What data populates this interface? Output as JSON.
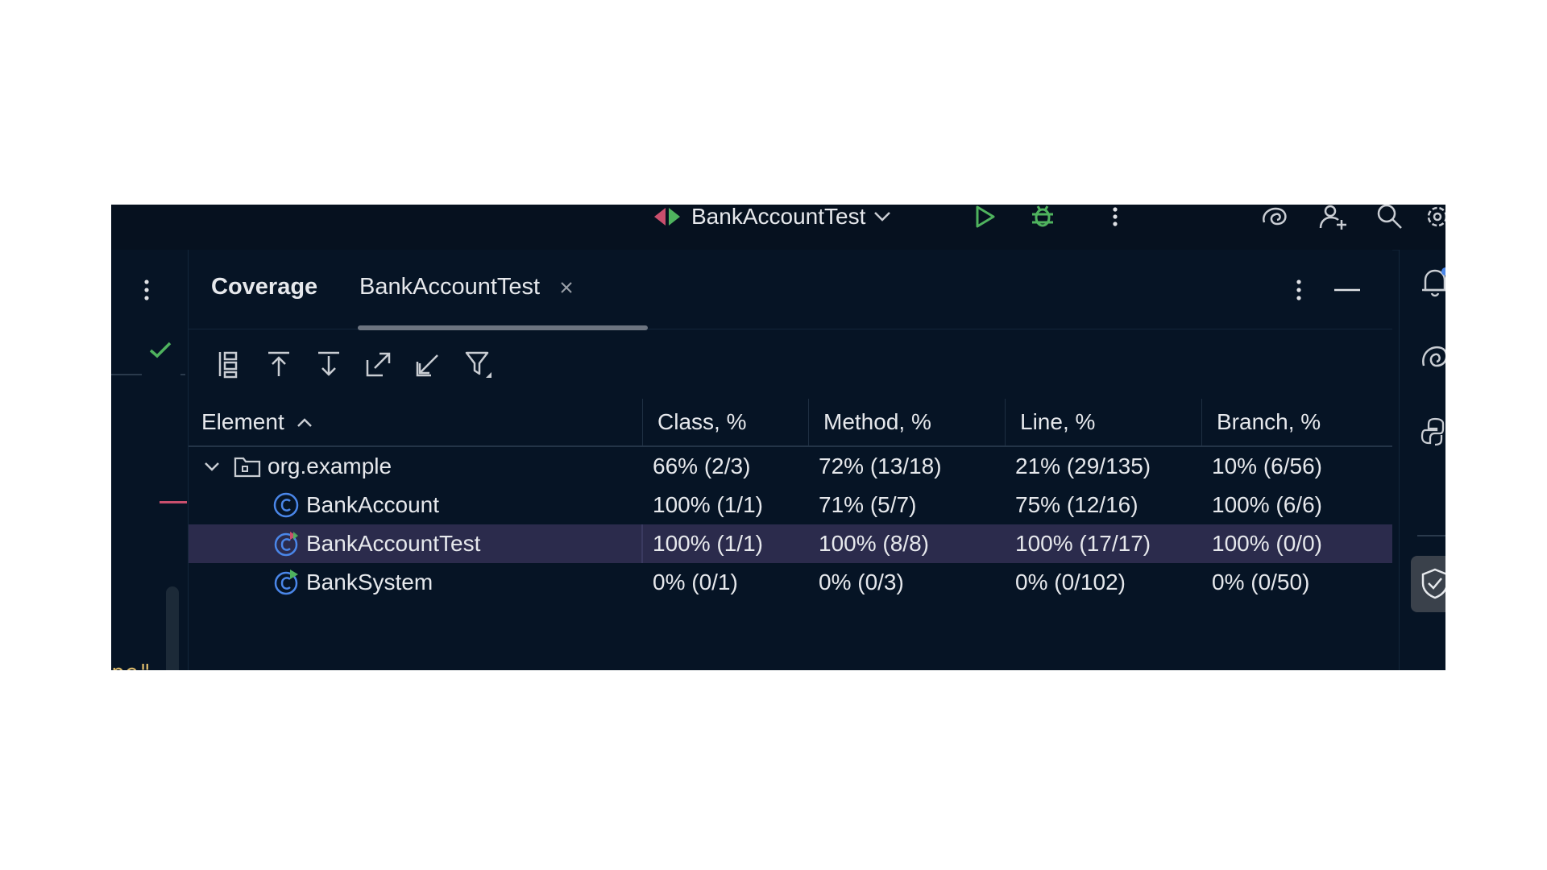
{
  "toolbar": {
    "run_config_name": "BankAccountTest",
    "icons": [
      "run-config-icon",
      "chevron-down-icon",
      "run-icon",
      "debug-icon",
      "more-vertical-icon",
      "ai-assistant-icon",
      "add-user-icon",
      "search-icon",
      "settings-icon"
    ]
  },
  "left_strip": {
    "code_fragment_string": "pe\"",
    "code_fragment_punct": ","
  },
  "panel": {
    "title": "Coverage",
    "tab_label": "BankAccountTest",
    "icons": [
      "flatten-packages-icon",
      "navigate-up-icon",
      "navigate-down-icon",
      "expand-all-icon",
      "collapse-all-icon",
      "filter-icon"
    ]
  },
  "table": {
    "headers": [
      "Element",
      "Class, %",
      "Method, %",
      "Line, %",
      "Branch, %"
    ],
    "rows": [
      {
        "name": "org.example",
        "type": "package",
        "class": "66% (2/3)",
        "method": "72% (13/18)",
        "line": "21% (29/135)",
        "branch": "10% (6/56)"
      },
      {
        "name": "BankAccount",
        "type": "class",
        "class": "100% (1/1)",
        "method": "71% (5/7)",
        "line": "75% (12/16)",
        "branch": "100% (6/6)"
      },
      {
        "name": "BankAccountTest",
        "type": "test-class",
        "class": "100% (1/1)",
        "method": "100% (8/8)",
        "line": "100% (17/17)",
        "branch": "100% (0/0)",
        "selected": true
      },
      {
        "name": "BankSystem",
        "type": "runnable-class",
        "class": "0% (0/1)",
        "method": "0% (0/3)",
        "line": "0% (0/102)",
        "branch": "0% (0/50)"
      }
    ]
  },
  "right_strip": {
    "icons": [
      "notifications-icon",
      "ai-assistant-icon",
      "python-console-icon",
      "coverage-shield-icon"
    ]
  },
  "colors": {
    "background": "#061425",
    "selected_row": "#2b2b4c",
    "text": "#e6e8ec",
    "run_green": "#4fb35e",
    "accent_blue": "#4a86e8",
    "error_red": "#c94f6d"
  }
}
